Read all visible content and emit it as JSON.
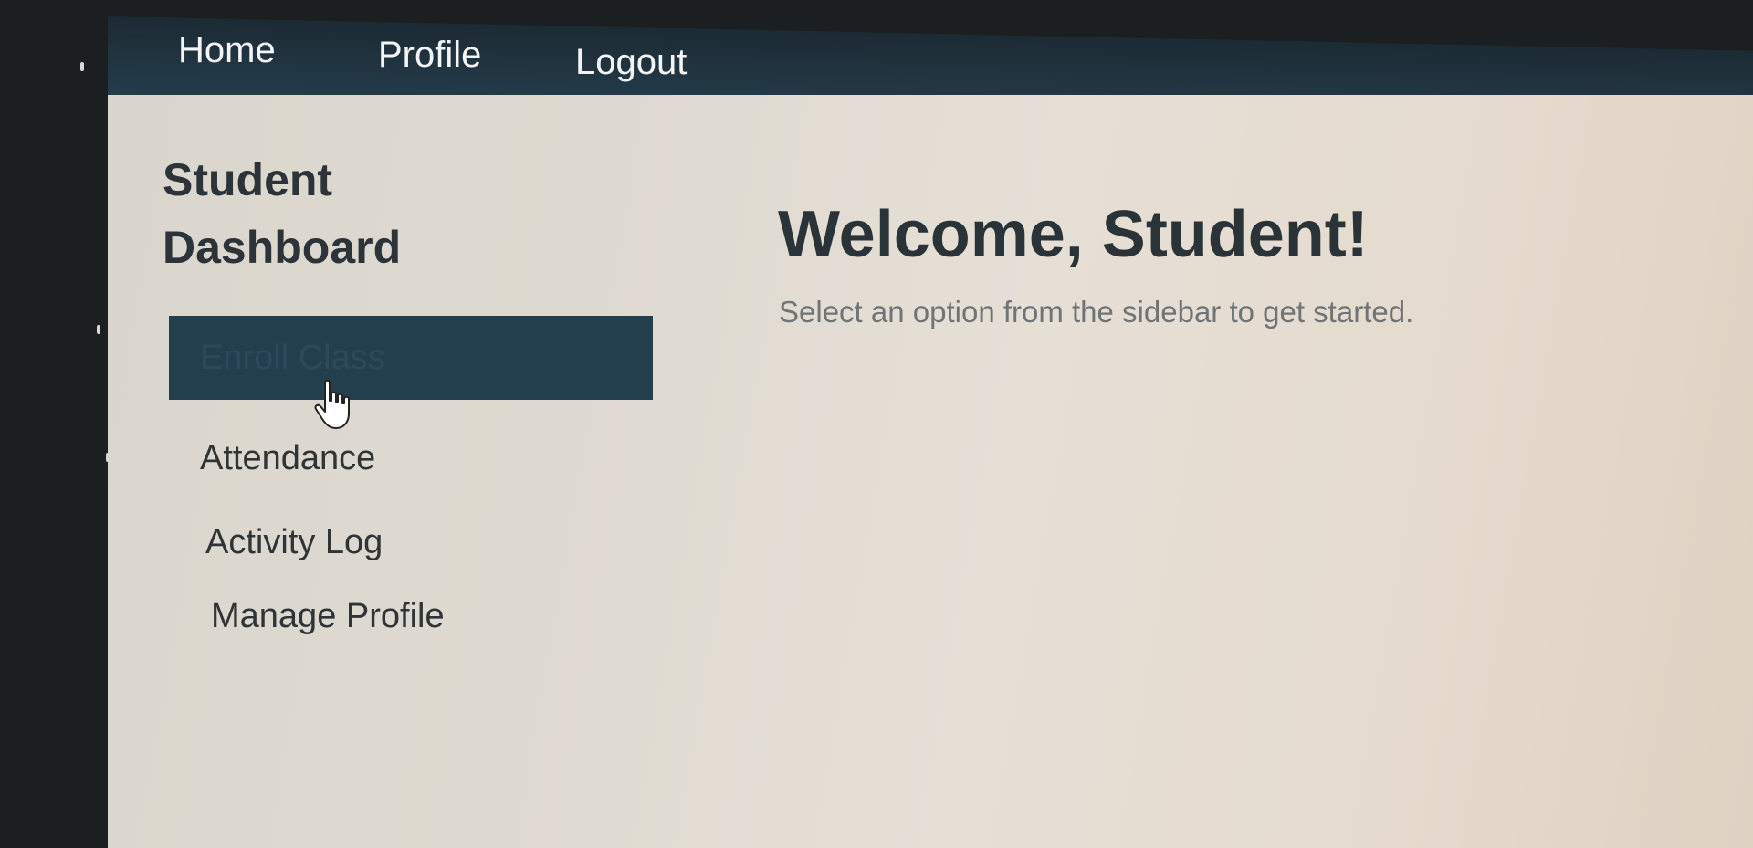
{
  "nav": {
    "home": "Home",
    "profile": "Profile",
    "logout": "Logout"
  },
  "sidebar": {
    "title": "Student Dashboard",
    "items": [
      {
        "label": "Enroll Class",
        "active": true
      },
      {
        "label": "Attendance",
        "active": false
      },
      {
        "label": "Activity Log",
        "active": false
      },
      {
        "label": "Manage Profile",
        "active": false
      }
    ]
  },
  "main": {
    "heading": "Welcome, Student!",
    "subtitle": "Select an option from the sidebar to get started."
  },
  "colors": {
    "navbar": "#223744",
    "active_item": "#233f4e",
    "page_background": "#e0dbd2",
    "heading_text": "#2a3338"
  },
  "icons": {
    "cursor": "hand-pointer-icon"
  }
}
